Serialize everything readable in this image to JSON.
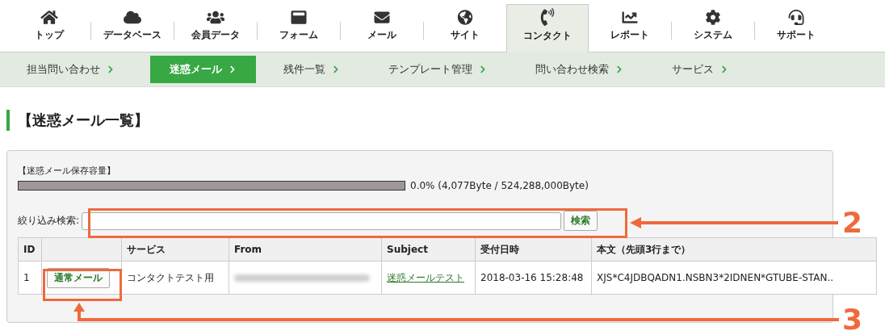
{
  "nav": {
    "items": [
      {
        "label": "トップ",
        "selected": false
      },
      {
        "label": "データベース",
        "selected": false
      },
      {
        "label": "会員データ",
        "selected": false
      },
      {
        "label": "フォーム",
        "selected": false
      },
      {
        "label": "メール",
        "selected": false
      },
      {
        "label": "サイト",
        "selected": false
      },
      {
        "label": "コンタクト",
        "selected": true
      },
      {
        "label": "レポート",
        "selected": false
      },
      {
        "label": "システム",
        "selected": false
      },
      {
        "label": "サポート",
        "selected": false
      }
    ]
  },
  "subnav": {
    "items": [
      {
        "label": "担当問い合わせ",
        "selected": false
      },
      {
        "label": "迷惑メール",
        "selected": true
      },
      {
        "label": "残件一覧",
        "selected": false
      },
      {
        "label": "テンプレート管理",
        "selected": false
      },
      {
        "label": "問い合わせ検索",
        "selected": false
      },
      {
        "label": "サービス",
        "selected": false
      }
    ]
  },
  "page_title": "【迷惑メール一覧】",
  "storage": {
    "label": "【迷惑メール保存容量】",
    "level": 0,
    "reading": "0.0% (4,077Byte / 524,288,000Byte)"
  },
  "search": {
    "label": "絞り込み検索:",
    "button": "検索"
  },
  "table": {
    "columns": [
      "ID",
      "",
      "サービス",
      "From",
      "Subject",
      "受付日時",
      "本文（先頭3行まで）"
    ],
    "rows": [
      {
        "id": "1",
        "button": "通常メール",
        "service": "コンタクトテスト用",
        "subject": "迷惑メールテスト",
        "received": "2018-03-16 15:28:48",
        "body": "XJS*C4JDBQADN1.NSBN3*2IDNEN*GTUBE-STAN.."
      }
    ]
  },
  "annotations": [
    {
      "number": "2"
    },
    {
      "number": "3"
    }
  ]
}
